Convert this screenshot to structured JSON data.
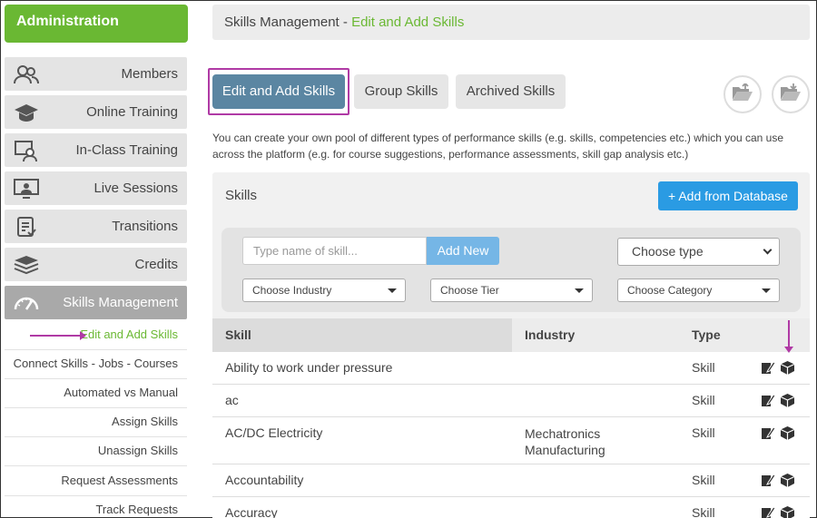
{
  "sidebar": {
    "header": "Administration",
    "items": [
      {
        "label": "Members",
        "icon": "members-icon"
      },
      {
        "label": "Online Training",
        "icon": "graduation-cap-icon"
      },
      {
        "label": "In-Class Training",
        "icon": "classroom-icon"
      },
      {
        "label": "Live Sessions",
        "icon": "presentation-icon"
      },
      {
        "label": "Transitions",
        "icon": "checklist-icon"
      },
      {
        "label": "Credits",
        "icon": "layers-icon"
      },
      {
        "label": "Skills Management",
        "icon": "gauge-icon"
      }
    ],
    "subitems": [
      "Edit and Add Skills",
      "Connect Skills - Jobs - Courses",
      "Automated vs Manual",
      "Assign Skills",
      "Unassign Skills",
      "Request Assessments",
      "Track Requests"
    ]
  },
  "breadcrumb": {
    "root": "Skills Management",
    "separator": " - ",
    "current": "Edit and Add Skills"
  },
  "tabs": [
    "Edit and Add Skills",
    "Group Skills",
    "Archived Skills"
  ],
  "toolbar": {
    "icons": [
      "folder-open-icon",
      "download-folder-icon"
    ]
  },
  "description": "You can create your own pool of different types of performance skills (e.g. skills, competencies etc.) which you can use across the platform (e.g. for course suggestions, performance assessments, skill gap analysis etc.)",
  "panel": {
    "title": "Skills",
    "add_db_label": "+ Add from Database",
    "search_placeholder": "Type name of skill...",
    "add_new_label": "Add New",
    "type_select": "Choose type",
    "industry_select": "Choose Industry",
    "tier_select": "Choose Tier",
    "category_select": "Choose Category"
  },
  "table": {
    "headers": {
      "skill": "Skill",
      "industry": "Industry",
      "type": "Type"
    },
    "rows": [
      {
        "skill": "Ability to work under pressure",
        "industry": "",
        "type": "Skill"
      },
      {
        "skill": "ac",
        "industry": "",
        "type": "Skill"
      },
      {
        "skill": "AC/DC Electricity",
        "industry": "Mechatronics Manufacturing",
        "type": "Skill"
      },
      {
        "skill": "Accountability",
        "industry": "",
        "type": "Skill"
      },
      {
        "skill": "Accuracy",
        "industry": "",
        "type": "Skill"
      }
    ]
  },
  "colors": {
    "brand_green": "#6ab833",
    "active_tab": "#5b86a2",
    "primary_blue": "#2a9be3",
    "annotation_magenta": "#b03aa5"
  }
}
